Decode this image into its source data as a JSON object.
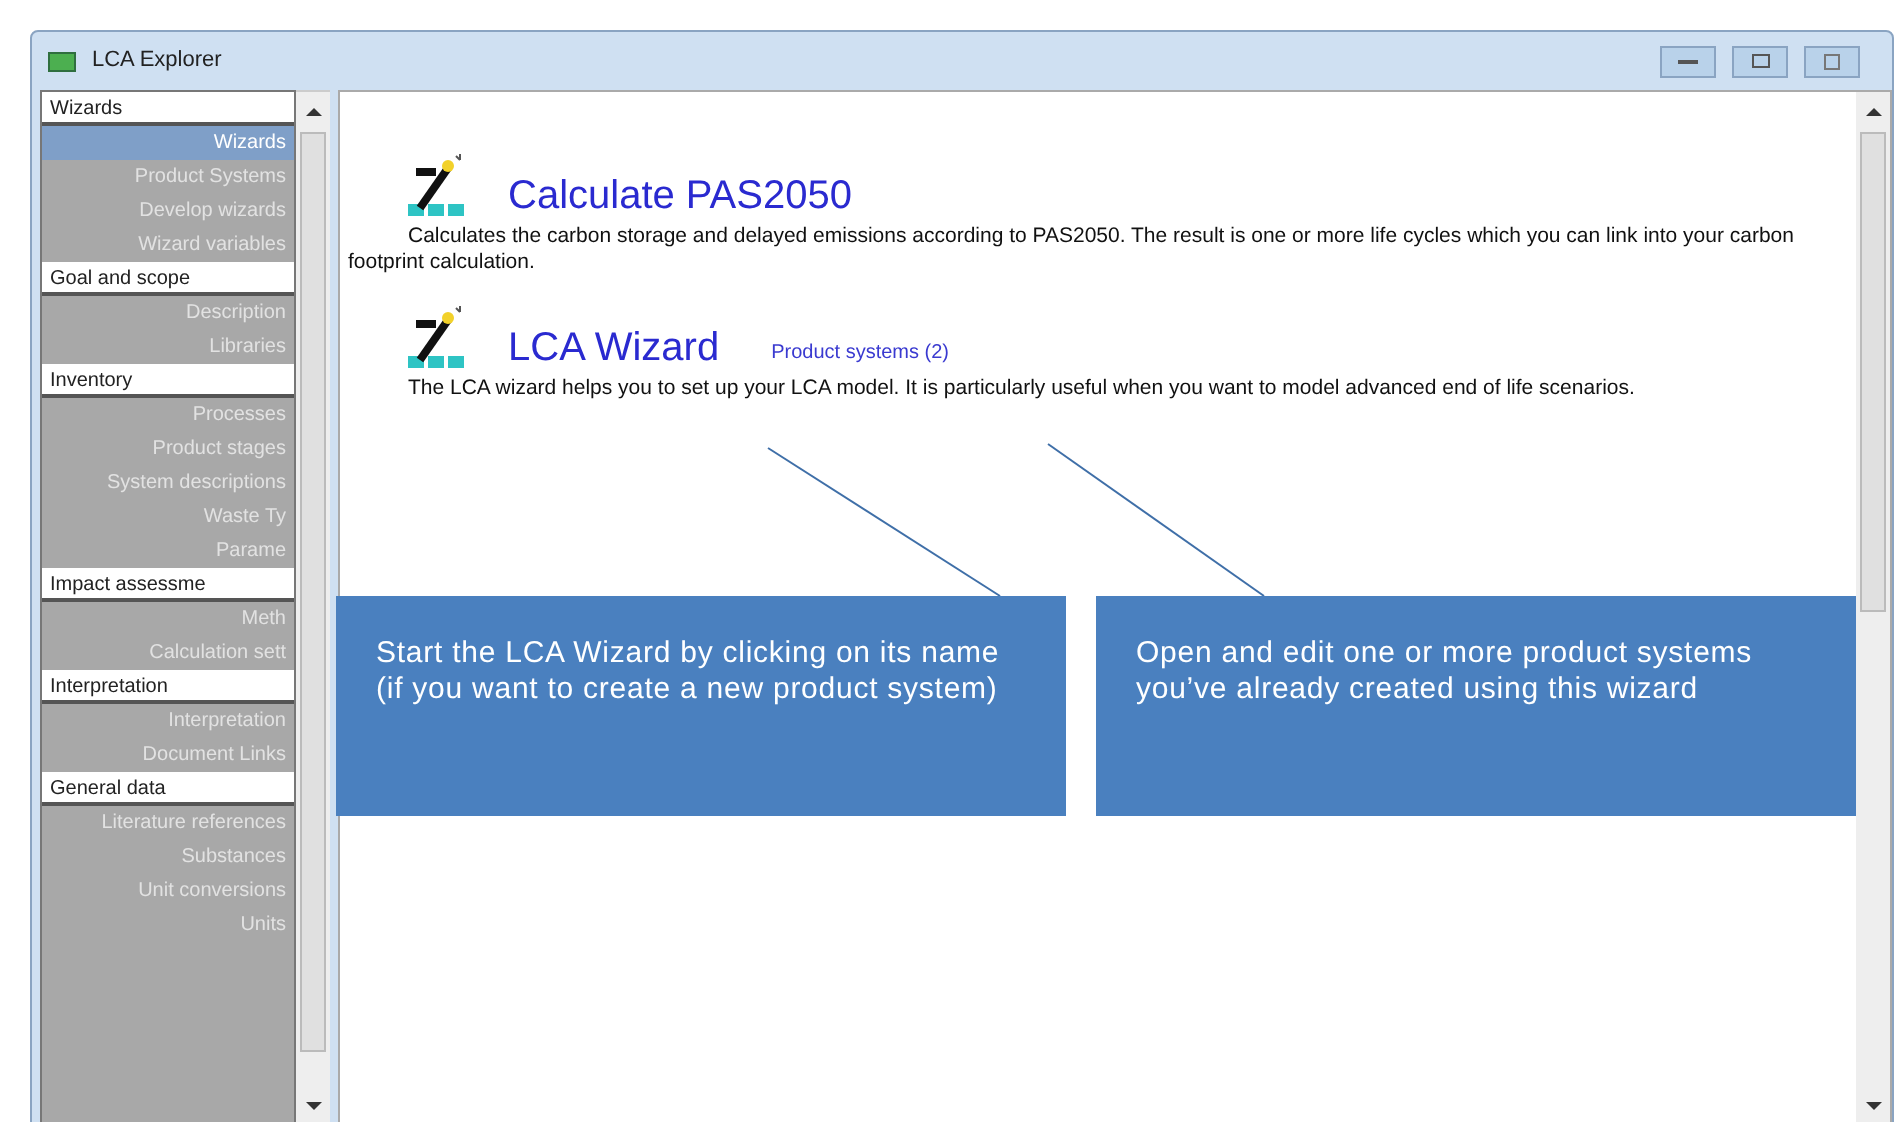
{
  "window": {
    "title": "LCA Explorer"
  },
  "sidebar": {
    "groups": [
      {
        "label": "Wizards",
        "items": [
          {
            "label": "Wizards",
            "selected": true
          },
          {
            "label": "Product Systems",
            "selected": false
          },
          {
            "label": "Develop wizards",
            "selected": false
          },
          {
            "label": "Wizard variables",
            "selected": false
          }
        ]
      },
      {
        "label": "Goal and scope",
        "items": [
          {
            "label": "Description",
            "selected": false
          },
          {
            "label": "Libraries",
            "selected": false
          }
        ]
      },
      {
        "label": "Inventory",
        "items": [
          {
            "label": "Processes",
            "selected": false
          },
          {
            "label": "Product stages",
            "selected": false
          },
          {
            "label": "System descriptions",
            "selected": false
          },
          {
            "label": "Waste Ty",
            "selected": false
          },
          {
            "label": "Parame",
            "selected": false
          }
        ]
      },
      {
        "label": "Impact assessme",
        "items": [
          {
            "label": "Meth",
            "selected": false
          },
          {
            "label": "Calculation sett",
            "selected": false
          }
        ]
      },
      {
        "label": "Interpretation",
        "items": [
          {
            "label": "Interpretation",
            "selected": false
          },
          {
            "label": "Document Links",
            "selected": false
          }
        ]
      },
      {
        "label": "General data",
        "items": [
          {
            "label": "Literature references",
            "selected": false
          },
          {
            "label": "Substances",
            "selected": false
          },
          {
            "label": "Unit conversions",
            "selected": false
          },
          {
            "label": "Units",
            "selected": false
          }
        ]
      }
    ]
  },
  "wizards": [
    {
      "title": "Calculate PAS2050",
      "description": "Calculates the carbon storage and delayed emissions according to PAS2050. The result is one or more life cycles which you can link into your carbon footprint calculation."
    },
    {
      "title": "LCA Wizard",
      "link": "Product systems (2)",
      "description": "The LCA wizard helps you to set up your LCA model. It is particularly useful when you want to model advanced end of life scenarios."
    }
  ],
  "callouts": [
    "Start the LCA Wizard by clicking on its name (if you want to create a new product system)",
    "Open and edit one or more product systems you’ve already created using this wizard"
  ]
}
